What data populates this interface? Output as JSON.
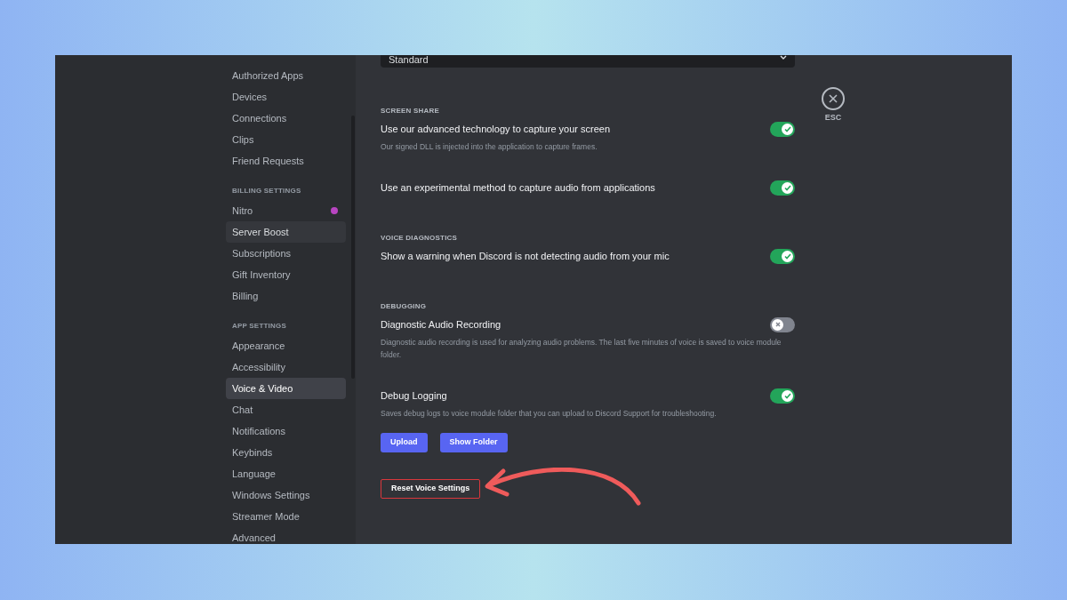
{
  "sidebar": {
    "sections": [
      {
        "items": [
          {
            "label": "Authorized Apps",
            "selected": false,
            "hovered": false,
            "dot": false
          },
          {
            "label": "Devices",
            "selected": false,
            "hovered": false,
            "dot": false
          },
          {
            "label": "Connections",
            "selected": false,
            "hovered": false,
            "dot": false
          },
          {
            "label": "Clips",
            "selected": false,
            "hovered": false,
            "dot": false
          },
          {
            "label": "Friend Requests",
            "selected": false,
            "hovered": false,
            "dot": false
          }
        ]
      },
      {
        "heading": "BILLING SETTINGS",
        "items": [
          {
            "label": "Nitro",
            "selected": false,
            "hovered": false,
            "dot": true
          },
          {
            "label": "Server Boost",
            "selected": false,
            "hovered": true,
            "dot": false
          },
          {
            "label": "Subscriptions",
            "selected": false,
            "hovered": false,
            "dot": false
          },
          {
            "label": "Gift Inventory",
            "selected": false,
            "hovered": false,
            "dot": false
          },
          {
            "label": "Billing",
            "selected": false,
            "hovered": false,
            "dot": false
          }
        ]
      },
      {
        "heading": "APP SETTINGS",
        "items": [
          {
            "label": "Appearance",
            "selected": false,
            "hovered": false,
            "dot": false
          },
          {
            "label": "Accessibility",
            "selected": false,
            "hovered": false,
            "dot": false
          },
          {
            "label": "Voice & Video",
            "selected": true,
            "hovered": false,
            "dot": false
          },
          {
            "label": "Chat",
            "selected": false,
            "hovered": false,
            "dot": false
          },
          {
            "label": "Notifications",
            "selected": false,
            "hovered": false,
            "dot": false
          },
          {
            "label": "Keybinds",
            "selected": false,
            "hovered": false,
            "dot": false
          },
          {
            "label": "Language",
            "selected": false,
            "hovered": false,
            "dot": false
          },
          {
            "label": "Windows Settings",
            "selected": false,
            "hovered": false,
            "dot": false
          },
          {
            "label": "Streamer Mode",
            "selected": false,
            "hovered": false,
            "dot": false
          },
          {
            "label": "Advanced",
            "selected": false,
            "hovered": false,
            "dot": false
          }
        ]
      }
    ]
  },
  "content": {
    "dropdown": {
      "value": "Standard"
    },
    "sections": [
      {
        "heading": "SCREEN SHARE",
        "rows": [
          {
            "title": "Use our advanced technology to capture your screen",
            "description": "Our signed DLL is injected into the application to capture frames.",
            "on": true
          },
          {
            "title": "Use an experimental method to capture audio from applications",
            "on": true
          }
        ]
      },
      {
        "heading": "VOICE DIAGNOSTICS",
        "rows": [
          {
            "title": "Show a warning when Discord is not detecting audio from your mic",
            "on": true
          }
        ]
      },
      {
        "heading": "DEBUGGING",
        "rows": [
          {
            "title": "Diagnostic Audio Recording",
            "description": "Diagnostic audio recording is used for analyzing audio problems. The last five minutes of voice is saved to voice module folder.",
            "on": false
          },
          {
            "title": "Debug Logging",
            "description": "Saves debug logs to voice module folder that you can upload to Discord Support for troubleshooting.",
            "on": true
          }
        ]
      }
    ],
    "buttons": [
      "Upload",
      "Show Folder"
    ],
    "reset_button": "Reset Voice Settings"
  },
  "close": {
    "label": "ESC"
  }
}
